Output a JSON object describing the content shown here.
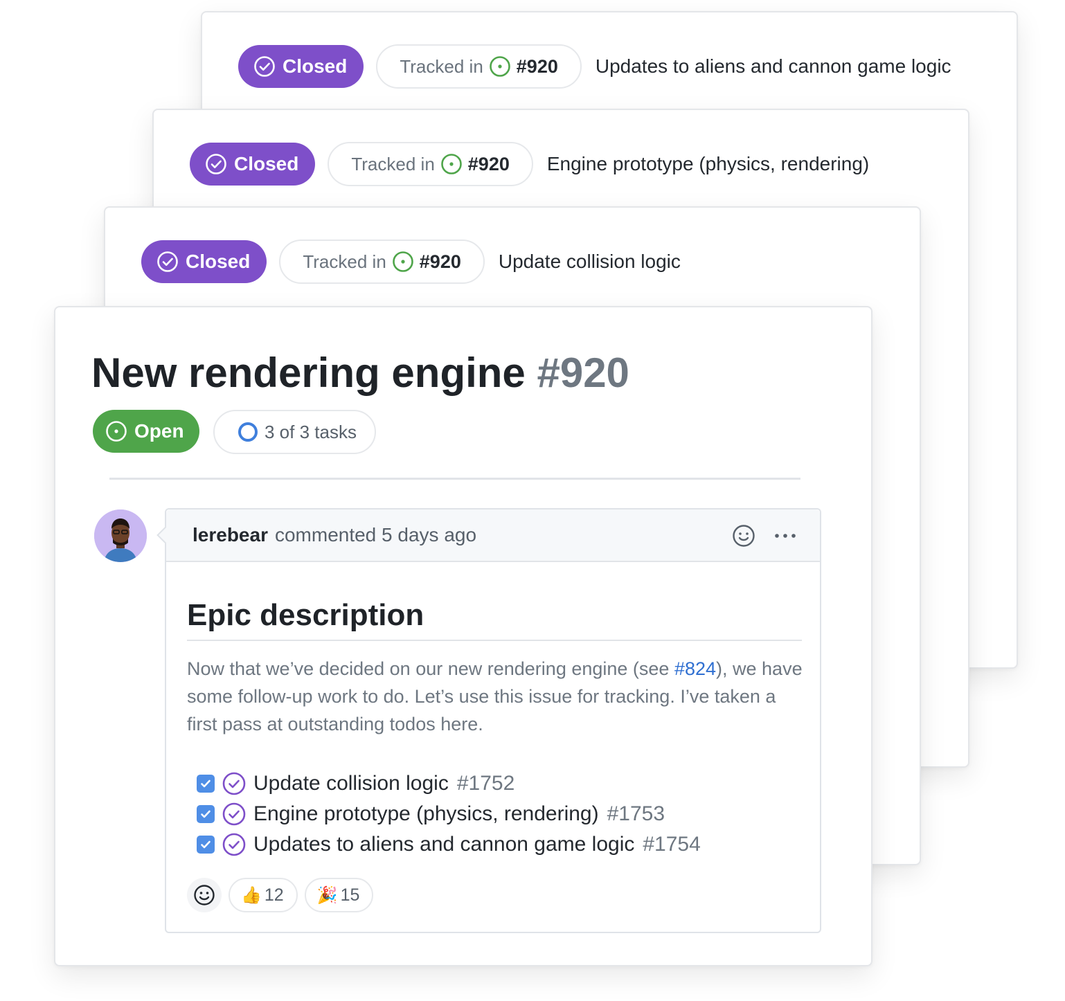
{
  "tracked_cards": [
    {
      "status": "Closed",
      "tracked_label": "Tracked in",
      "tracked_number": "#920",
      "title": "Updates to aliens and cannon game logic"
    },
    {
      "status": "Closed",
      "tracked_label": "Tracked in",
      "tracked_number": "#920",
      "title": "Engine prototype (physics, rendering)"
    },
    {
      "status": "Closed",
      "tracked_label": "Tracked in",
      "tracked_number": "#920",
      "title": "Update collision logic"
    }
  ],
  "issue": {
    "title": "New rendering engine",
    "number": "#920",
    "status": "Open",
    "tasks_progress": "3 of 3 tasks"
  },
  "comment": {
    "author": "lerebear",
    "action": "commented 5 days ago",
    "heading": "Epic description",
    "text_before_link": "Now that we’ve decided on our new rendering engine (see ",
    "link": "#824",
    "text_after_link": "), we have some follow-up work to do. Let’s use this issue for tracking. I’ve taken a first pass at outstanding todos here.",
    "tasks": [
      {
        "title": "Update collision logic",
        "number": "#1752",
        "checked": true
      },
      {
        "title": "Engine prototype (physics, rendering)",
        "number": "#1753",
        "checked": true
      },
      {
        "title": "Updates to aliens and cannon game logic",
        "number": "#1754",
        "checked": true
      }
    ],
    "reactions": [
      {
        "emoji": "👍",
        "count": "12"
      },
      {
        "emoji": "🎉",
        "count": "15"
      }
    ]
  },
  "colors": {
    "closed_purple": "#7e4fc9",
    "open_green": "#4fa54a",
    "link_blue": "#2f6fd1",
    "checkbox_blue": "#4f8ee6"
  },
  "icons": {
    "closed": "check-circle-icon",
    "open": "issue-open-icon",
    "tasks": "progress-ring-icon",
    "reaction": "smiley-icon",
    "more": "kebab-horizontal-icon"
  }
}
